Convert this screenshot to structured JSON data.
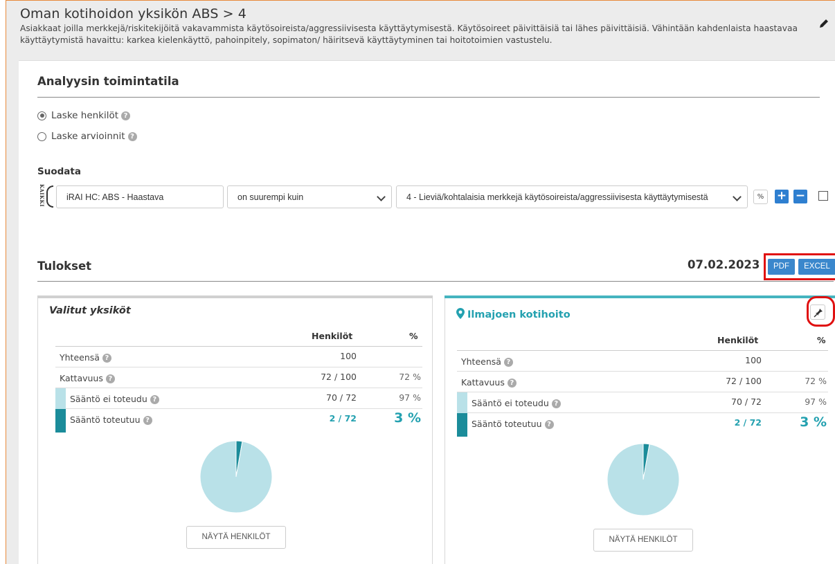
{
  "header": {
    "title": "Oman kotihoidon yksikön ABS > 4",
    "description": "Asiakkaat joilla merkkejä/riskitekijöitä vakavammista käytösoireista/aggressiivisesta käyttäytymisestä. Käytösoireet päivittäisiä tai lähes päivittäisiä. Vähintään kahdenlaista haastavaa käyttäytymistä havaittu: karkea kielenkäyttö, pahoinpitely, sopimaton/ häiritsevä käyttäytyminen tai hoitotoimien vastustelu."
  },
  "analysis": {
    "title": "Analyysin toimintatila",
    "options": [
      {
        "label": "Laske henkilöt",
        "selected": true
      },
      {
        "label": "Laske arvioinnit",
        "selected": false
      }
    ]
  },
  "filter": {
    "title": "Suodata",
    "group_label": "KAIKKI",
    "field": "iRAI HC: ABS - Haastava",
    "operator": "on suurempi kuin",
    "value": "4 - Lieviä/kohtalaisia merkkejä käytösoireista/aggressiivisesta käyttäytymisestä",
    "pct_label": "%",
    "add_label": "+",
    "remove_label": "−"
  },
  "results": {
    "title": "Tulokset",
    "date": "07.02.2023",
    "pdf_label": "PDF",
    "excel_label": "EXCEL"
  },
  "colors": {
    "accent": "#24a1b0",
    "light_fill": "#b9e1e8",
    "dark_fill": "#1b8c9a",
    "button_blue": "#3a87cc",
    "highlight_red": "#e01010"
  },
  "cards": [
    {
      "title": "Valitut yksiköt",
      "col_persons": "Henkilöt",
      "col_pct": "%",
      "rows": [
        {
          "label": "Yhteensä",
          "value": "100",
          "pct": ""
        },
        {
          "label": "Kattavuus",
          "value": "72 / 100",
          "pct": "72 %"
        },
        {
          "label": "Sääntö ei toteudu",
          "value": "70 / 72",
          "pct": "97 %"
        },
        {
          "label": "Sääntö toteutuu",
          "value": "2 / 72",
          "pct": "3 %"
        }
      ],
      "button": "NÄYTÄ HENKILÖT"
    },
    {
      "title": "Ilmajoen kotihoito",
      "col_persons": "Henkilöt",
      "col_pct": "%",
      "rows": [
        {
          "label": "Yhteensä",
          "value": "100",
          "pct": ""
        },
        {
          "label": "Kattavuus",
          "value": "72 / 100",
          "pct": "72 %"
        },
        {
          "label": "Sääntö ei toteudu",
          "value": "70 / 72",
          "pct": "97 %"
        },
        {
          "label": "Sääntö toteutuu",
          "value": "2 / 72",
          "pct": "3 %"
        }
      ],
      "button": "NÄYTÄ HENKILÖT"
    }
  ],
  "chart_data": [
    {
      "type": "pie",
      "categories": [
        "Sääntö ei toteudu",
        "Sääntö toteutuu"
      ],
      "values": [
        70,
        2
      ],
      "colors": [
        "#b9e1e8",
        "#1b8c9a"
      ]
    },
    {
      "type": "pie",
      "categories": [
        "Sääntö ei toteudu",
        "Sääntö toteutuu"
      ],
      "values": [
        70,
        2
      ],
      "colors": [
        "#b9e1e8",
        "#1b8c9a"
      ]
    }
  ]
}
